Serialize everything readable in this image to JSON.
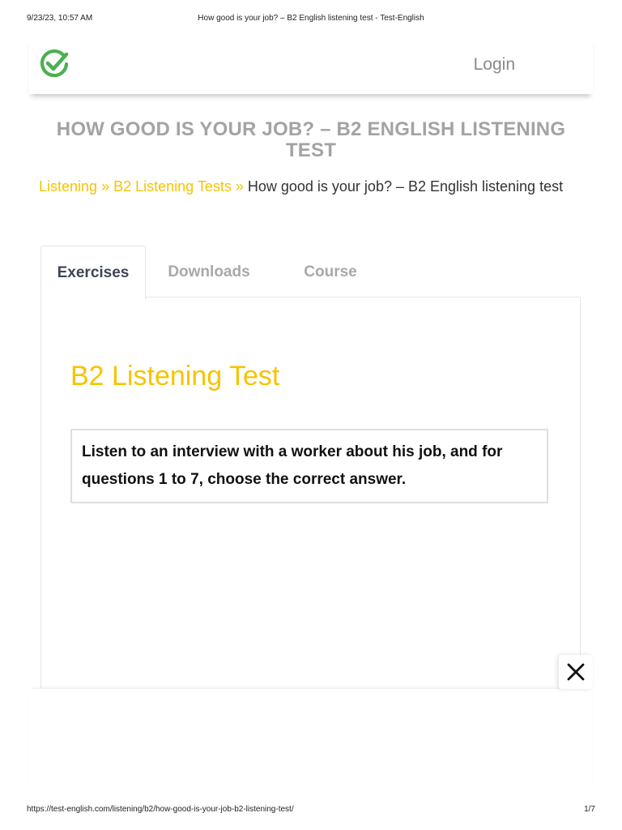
{
  "print": {
    "date": "9/23/23, 10:57 AM",
    "title": "How good is your job? – B2 English listening test - Test-English",
    "url": "https://test-english.com/listening/b2/how-good-is-your-job-b2-listening-test/",
    "pages": "1/7"
  },
  "header": {
    "logo_icon": "checkmark-circle-icon",
    "logo_color": "#4caf50",
    "login_label": "Login"
  },
  "page_title": "HOW GOOD IS YOUR JOB? – B2 ENGLISH LISTENING TEST",
  "breadcrumb": {
    "items": [
      "Listening",
      "B2 Listening Tests"
    ],
    "separator": " » ",
    "current": "How good is your job? – B2 English listening test"
  },
  "tabs": [
    {
      "label": "Exercises",
      "active": true
    },
    {
      "label": "Downloads",
      "active": false
    },
    {
      "label": "Course",
      "active": false
    }
  ],
  "panel": {
    "heading": "B2 Listening Test",
    "instruction": "Listen to an interview with a worker about his job, and for questions 1 to 7, choose the correct answer."
  },
  "close_icon": "close-icon",
  "colors": {
    "accent": "#f5c400",
    "title_gray": "#a3a3a3",
    "tab_active": "#3d4553"
  }
}
